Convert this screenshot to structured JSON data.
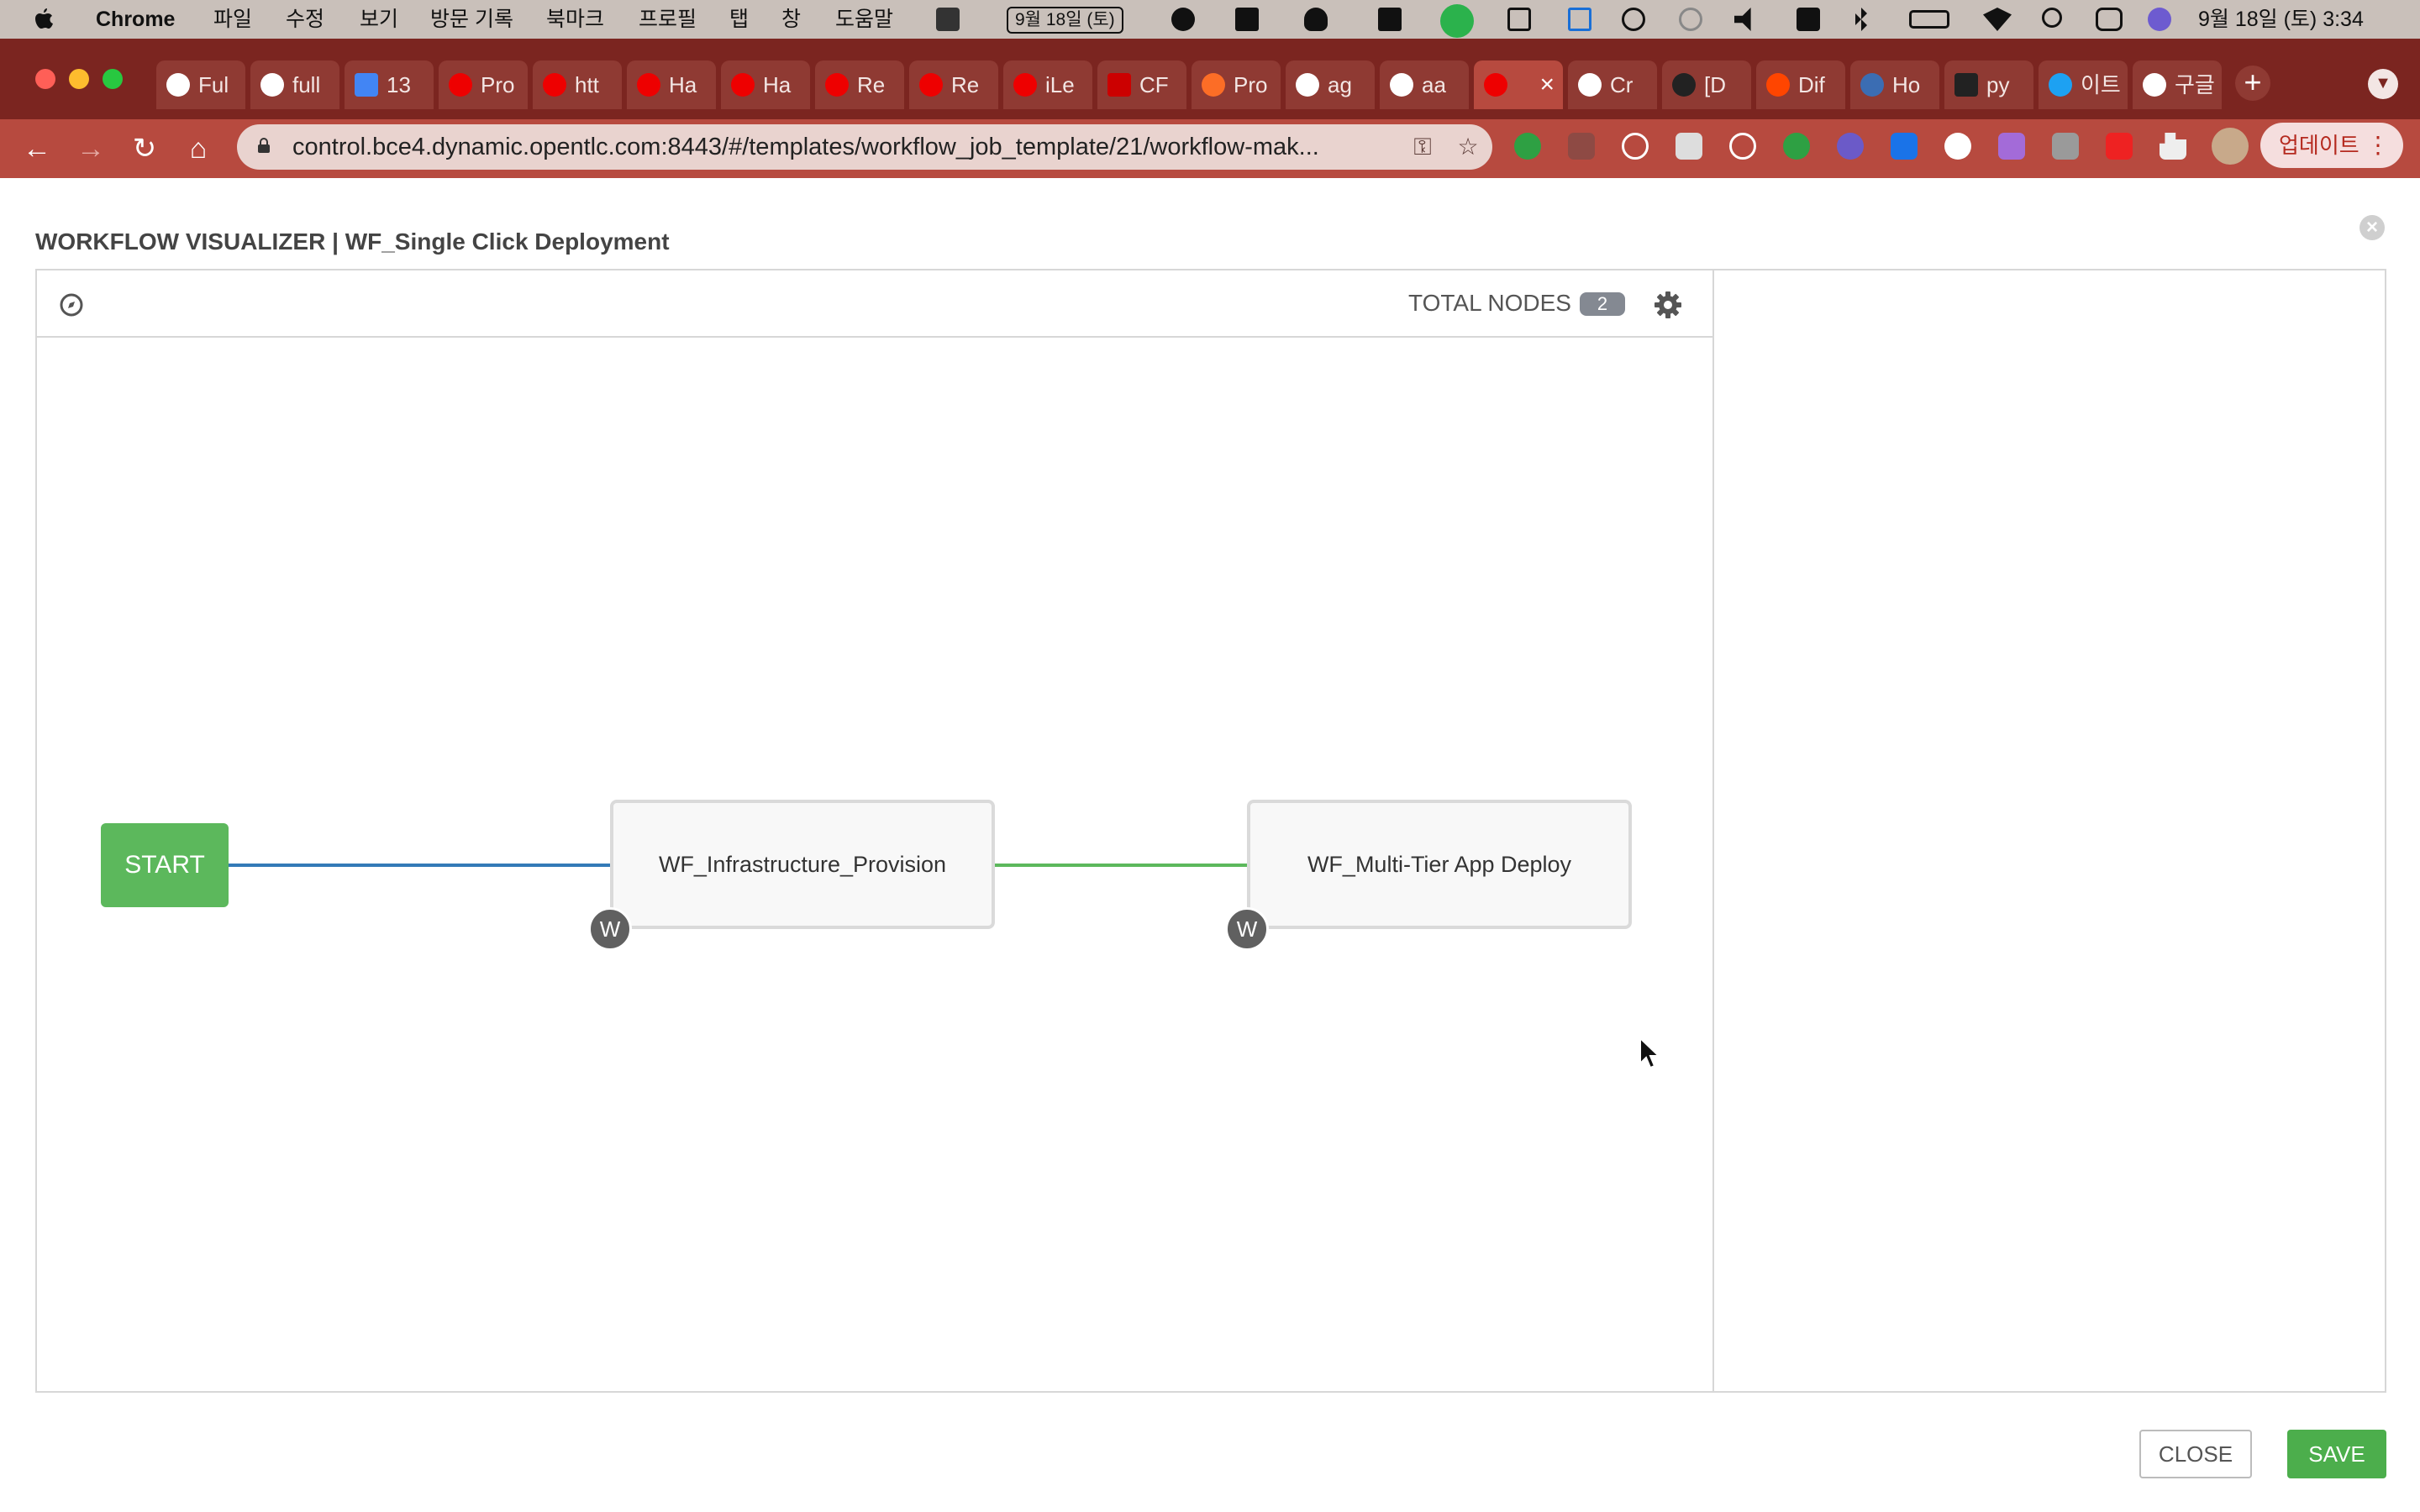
{
  "os_menubar": {
    "app_name": "Chrome",
    "menus": [
      "파일",
      "수정",
      "보기",
      "방문 기록",
      "북마크",
      "프로필",
      "탭",
      "창",
      "도움말"
    ],
    "date_badge": "9월 18일 (토)",
    "clock": "9월 18일 (토) 3:34"
  },
  "browser": {
    "tabs": [
      {
        "title": "Ful"
      },
      {
        "title": "full"
      },
      {
        "title": "13"
      },
      {
        "title": "Pro"
      },
      {
        "title": "htt"
      },
      {
        "title": "Ha"
      },
      {
        "title": "Ha"
      },
      {
        "title": "Re"
      },
      {
        "title": "Re"
      },
      {
        "title": "iLe"
      },
      {
        "title": "CF"
      },
      {
        "title": "Pro"
      },
      {
        "title": "ag"
      },
      {
        "title": "aa"
      },
      {
        "title": ""
      },
      {
        "title": "Cr"
      },
      {
        "title": "[D"
      },
      {
        "title": "Dif"
      },
      {
        "title": "Ho"
      },
      {
        "title": "py"
      },
      {
        "title": "이트"
      },
      {
        "title": "구글"
      }
    ],
    "url": "control.bce4.dynamic.opentlc.com:8443/#/templates/workflow_job_template/21/workflow-mak...",
    "update_button": "업데이트"
  },
  "workflow": {
    "title": "WORKFLOW VISUALIZER | WF_Single Click Deployment",
    "total_nodes_label": "TOTAL NODES",
    "total_nodes_count": "2",
    "start_label": "START",
    "nodes": [
      {
        "name": "WF_Infrastructure_Provision",
        "badge": "W"
      },
      {
        "name": "WF_Multi-Tier App Deploy",
        "badge": "W"
      }
    ],
    "edge_colors": {
      "start_edge": "#337ab7",
      "success_edge": "#5cb85c"
    }
  },
  "footer": {
    "close_label": "CLOSE",
    "save_label": "SAVE"
  }
}
